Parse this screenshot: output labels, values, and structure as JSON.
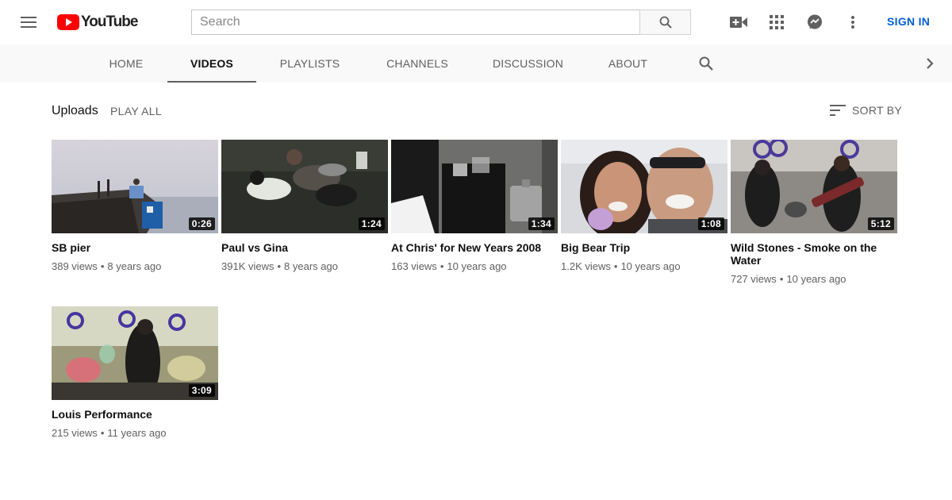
{
  "masthead": {
    "logo_text": "YouTube",
    "search_placeholder": "Search",
    "sign_in": "SIGN IN"
  },
  "tabs": [
    {
      "label": "HOME",
      "active": false
    },
    {
      "label": "VIDEOS",
      "active": true
    },
    {
      "label": "PLAYLISTS",
      "active": false
    },
    {
      "label": "CHANNELS",
      "active": false
    },
    {
      "label": "DISCUSSION",
      "active": false
    },
    {
      "label": "ABOUT",
      "active": false
    }
  ],
  "section": {
    "title": "Uploads",
    "play_all": "PLAY ALL",
    "sort_by": "SORT BY"
  },
  "videos": [
    {
      "title": "SB pier",
      "duration": "0:26",
      "views": "389 views",
      "age": "8 years ago"
    },
    {
      "title": "Paul vs Gina",
      "duration": "1:24",
      "views": "391K views",
      "age": "8 years ago"
    },
    {
      "title": "At Chris' for New Years 2008",
      "duration": "1:34",
      "views": "163 views",
      "age": "10 years ago"
    },
    {
      "title": "Big Bear Trip",
      "duration": "1:08",
      "views": "1.2K views",
      "age": "10 years ago"
    },
    {
      "title": "Wild Stones - Smoke on the Water",
      "duration": "5:12",
      "views": "727 views",
      "age": "10 years ago"
    },
    {
      "title": "Louis Performance",
      "duration": "3:09",
      "views": "215 views",
      "age": "11 years ago"
    }
  ],
  "meta_separator": "•",
  "colors": {
    "brand_red": "#ff0000",
    "link_blue": "#065fd4",
    "tab_bar_bg": "#f9f9f9"
  },
  "icons": {
    "menu": "hamburger-menu-icon",
    "search": "magnifier-icon",
    "upload": "video-camera-plus-icon",
    "apps": "grid-apps-icon",
    "messages": "chat-bubble-icon",
    "more": "vertical-dots-icon",
    "sort": "sort-lines-icon",
    "next": "chevron-right-icon"
  }
}
